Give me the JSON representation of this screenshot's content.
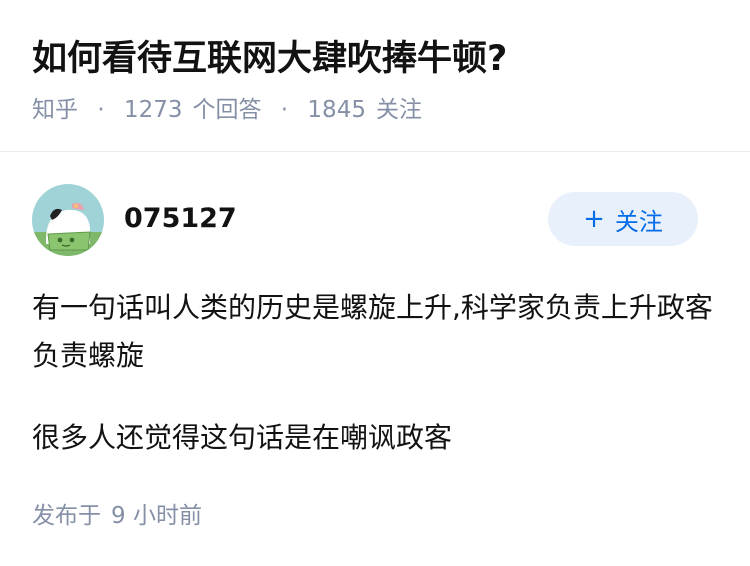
{
  "question": {
    "title": "如何看待互联网大肆吹捧牛顿?",
    "source": "知乎",
    "separator": "·",
    "answer_count": "1273",
    "answer_label": "个回答",
    "follower_count": "1845",
    "follower_label": "关注"
  },
  "author": {
    "name": "075127",
    "follow_button_plus": "+",
    "follow_button_label": "关注"
  },
  "answer": {
    "paragraphs": [
      "有一句话叫人类的历史是螺旋上升,科学家负责上升政客负责螺旋",
      "很多人还觉得这句话是在嘲讽政客"
    ],
    "published_prefix": "发布于",
    "published_time": "9 小时前"
  },
  "colors": {
    "accent": "#056de8",
    "follow_bg": "#e8f0fb",
    "meta_text": "#8590a6",
    "avatar_bg": "#9fd3d8"
  }
}
